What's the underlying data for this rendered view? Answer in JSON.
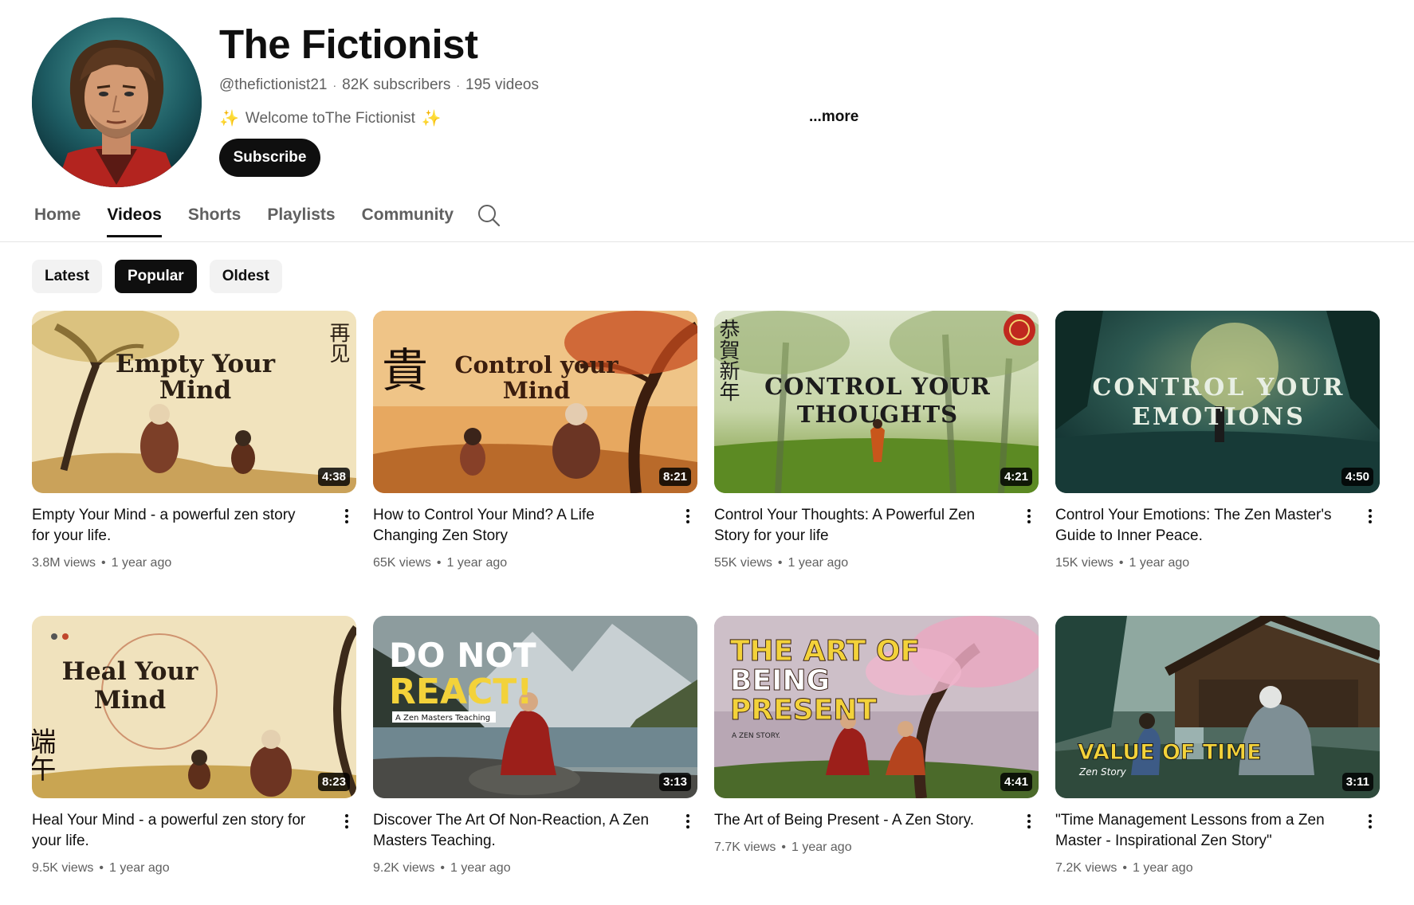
{
  "channel": {
    "name": "The Fictionist",
    "handle": "@thefictionist21",
    "subscribers": "82K subscribers",
    "videos": "195 videos",
    "description_prefix": "Welcome toThe Fictionist",
    "spark_glyph": "✨",
    "more_label": "...more",
    "subscribe_label": "Subscribe",
    "separator": "·"
  },
  "tabs": [
    {
      "label": "Home",
      "active": false
    },
    {
      "label": "Videos",
      "active": true
    },
    {
      "label": "Shorts",
      "active": false
    },
    {
      "label": "Playlists",
      "active": false
    },
    {
      "label": "Community",
      "active": false
    }
  ],
  "chips": [
    {
      "label": "Latest",
      "active": false
    },
    {
      "label": "Popular",
      "active": true
    },
    {
      "label": "Oldest",
      "active": false
    }
  ],
  "videos": [
    {
      "title": "Empty Your Mind - a powerful zen story for your life.",
      "views": "3.8M views",
      "age": "1 year ago",
      "duration": "4:38",
      "thumb_text": [
        "Empty Your",
        "Mind"
      ],
      "thumb_side": "再见"
    },
    {
      "title": "How to Control Your Mind? A Life Changing Zen Story",
      "views": "65K views",
      "age": "1 year ago",
      "duration": "8:21",
      "thumb_text": [
        "Control your",
        "Mind"
      ],
      "thumb_side": "貴"
    },
    {
      "title": "Control Your Thoughts: A Powerful Zen Story for your life",
      "views": "55K views",
      "age": "1 year ago",
      "duration": "4:21",
      "thumb_text": [
        "CONTROL YOUR",
        "THOUGHTS"
      ],
      "thumb_side": "恭賀新年"
    },
    {
      "title": "Control Your Emotions: The Zen Master's Guide to Inner Peace.",
      "views": "15K views",
      "age": "1 year ago",
      "duration": "4:50",
      "thumb_text": [
        "CONTROL YOUR",
        "EMOTIONS"
      ]
    },
    {
      "title": "Heal Your Mind - a powerful zen story for your life.",
      "views": "9.5K views",
      "age": "1 year ago",
      "duration": "8:23",
      "thumb_text": [
        "Heal Your",
        "Mind"
      ],
      "thumb_side": "端午"
    },
    {
      "title": "Discover The Art Of Non-Reaction, A Zen Masters Teaching.",
      "views": "9.2K views",
      "age": "1 year ago",
      "duration": "3:13",
      "thumb_text": [
        "DO NOT",
        "REACT!"
      ],
      "thumb_sub": "A Zen Masters Teaching"
    },
    {
      "title": "The Art of Being Present - A Zen Story.",
      "views": "7.7K views",
      "age": "1 year ago",
      "duration": "4:41",
      "thumb_text": [
        "THE ART OF",
        "BEING",
        "PRESENT"
      ],
      "thumb_sub": "A ZEN STORY."
    },
    {
      "title": "\"Time Management Lessons from a Zen Master - Inspirational Zen Story\"",
      "views": "7.2K views",
      "age": "1 year ago",
      "duration": "3:11",
      "thumb_text": [
        "VALUE OF TIME"
      ],
      "thumb_sub": "Zen Story"
    }
  ],
  "colors": {
    "text_primary": "#0f0f0f",
    "text_secondary": "#606060",
    "chip_bg": "#f2f2f2",
    "chip_active_bg": "#0f0f0f",
    "divider": "#e5e5e5"
  }
}
